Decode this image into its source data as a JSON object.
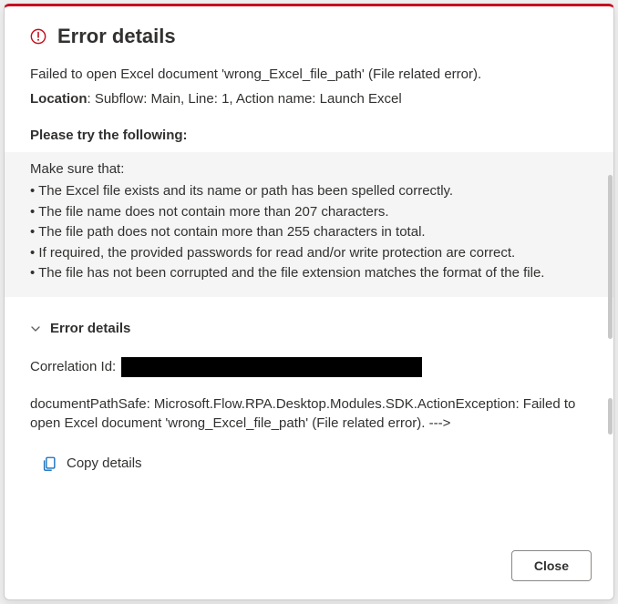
{
  "header": {
    "title": "Error details"
  },
  "body": {
    "error_message": "Failed to open Excel document 'wrong_Excel_file_path' (File related error).",
    "location_label": "Location",
    "location_value": ": Subflow: Main, Line: 1, Action name: Launch Excel",
    "try_header": "Please try the following:",
    "make_sure": "Make sure that:",
    "bullets": [
      "• The Excel file exists and its name or path has been spelled correctly.",
      "• The file name does not contain more than 207 characters.",
      "• The file path does not contain more than 255 characters in total.",
      "• If required, the provided passwords for read and/or write protection are correct.",
      "• The file has not been corrupted and the file extension matches the format of the file."
    ]
  },
  "details": {
    "toggle_label": "Error details",
    "correlation_label": "Correlation Id:",
    "exception_text": "documentPathSafe: Microsoft.Flow.RPA.Desktop.Modules.SDK.ActionException: Failed to open Excel document 'wrong_Excel_file_path' (File related error). --->",
    "copy_label": "Copy details"
  },
  "footer": {
    "close_label": "Close"
  }
}
